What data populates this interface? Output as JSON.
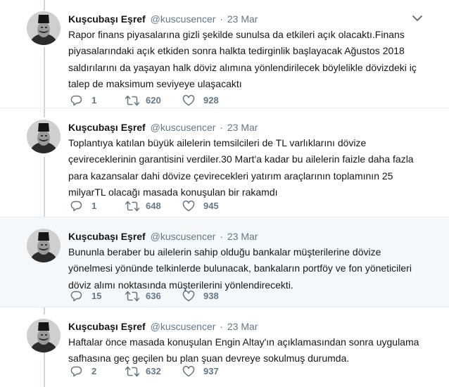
{
  "tweets": [
    {
      "name": "Kuşcubaşı Eşref",
      "handle": "@kuscusencer",
      "separator": "·",
      "time": "23 Mar",
      "lines": [
        "Rapor finans piyasalarına gizli şekilde sunulsa da etkileri açık olacaktı.Finans",
        "piyasalarındaki açık etkiden sonra halkta tedirginlik başlayacak Ağustos 2018",
        "saldırılarını da yaşayan halk döviz alımına yönlendirilecek böylelikle dövizdeki iç",
        "talep de maksimum seviyeye ulaşacaktı"
      ],
      "replies": "1",
      "retweets": "620",
      "likes": "928"
    },
    {
      "name": "Kuşcubaşı Eşref",
      "handle": "@kuscusencer",
      "separator": "·",
      "time": "23 Mar",
      "lines": [
        "Toplantıya katılan büyük ailelerin temsilcileri de TL varlıklarını dövize",
        "çevireceklerinin garantisini verdiler.30 Mart'a kadar bu ailelerin faizle daha fazla",
        "para kazansalar dahi dövize çevirecekleri yatırım araçlarının toplamının 25",
        "milyarTL olacağı masada konuşulan bir rakamdı"
      ],
      "replies": "1",
      "retweets": "648",
      "likes": "945"
    },
    {
      "name": "Kuşcubaşı Eşref",
      "handle": "@kuscusencer",
      "separator": "·",
      "time": "23 Mar",
      "lines": [
        "Bununla beraber bu ailelerin sahip olduğu bankalar müşterilerine dövize",
        "yönelmesi yönünde telkinlerde bulunacak, bankaların portföy ve fon yöneticileri",
        "döviz alımı noktasında müşterilerini yönlendirecekti."
      ],
      "replies": "15",
      "retweets": "636",
      "likes": "938"
    },
    {
      "name": "Kuşcubaşı Eşref",
      "handle": "@kuscusencer",
      "separator": "·",
      "time": "23 Mar",
      "lines": [
        "Haftalar önce masada konuşulan Engin Altay'ın açıklamasından sonra uygulama",
        "safhasına geç geçilen bu plan şuan devreye sokulmuş durumda."
      ],
      "replies": "2",
      "retweets": "632",
      "likes": "937"
    }
  ],
  "icons": {
    "avatar": "fez-portrait-avatar",
    "reply": "reply-icon",
    "retweet": "retweet-icon",
    "like": "heart-icon",
    "more": "chevron-down-icon"
  },
  "colors": {
    "text": "#14171a",
    "secondary": "#657786",
    "thread_line": "#ccd6dd",
    "highlight_bg": "#f5f8fa"
  }
}
